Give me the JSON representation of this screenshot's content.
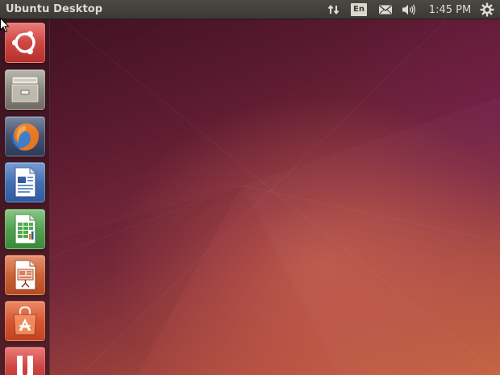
{
  "top_panel": {
    "title": "Ubuntu Desktop",
    "indicators": {
      "network_icon": "network-transfer-icon",
      "keyboard_layout": "En",
      "mail_icon": "envelope-icon",
      "sound_icon": "speaker-icon",
      "clock": "1:45 PM",
      "session_icon": "gear-icon"
    }
  },
  "launcher": {
    "items": [
      {
        "name": "dash-home",
        "icon": "ubuntu-logo-icon"
      },
      {
        "name": "files",
        "icon": "file-cabinet-icon"
      },
      {
        "name": "firefox",
        "icon": "firefox-icon"
      },
      {
        "name": "libreoffice-writer",
        "icon": "writer-document-icon"
      },
      {
        "name": "libreoffice-calc",
        "icon": "calc-spreadsheet-icon"
      },
      {
        "name": "libreoffice-impress",
        "icon": "impress-presentation-icon"
      },
      {
        "name": "ubuntu-software-center",
        "icon": "shopping-bag-icon"
      },
      {
        "name": "ubuntu-one",
        "icon": "ubuntu-one-icon"
      }
    ]
  },
  "colors": {
    "panel_bg": "#3b3a36",
    "panel_text": "#dfdbd2",
    "wallpaper_dark": "#3b0f1f",
    "wallpaper_warm": "#c4623f",
    "ubuntu_orange": "#dd4814"
  }
}
